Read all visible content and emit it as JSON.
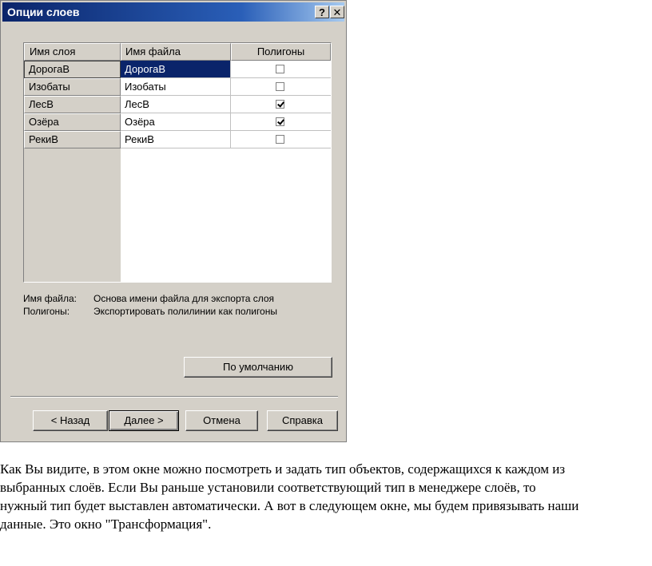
{
  "dialog": {
    "title": "Опции слоев",
    "help_button": "?",
    "close_button": "✕",
    "columns": [
      "Имя слоя",
      "Имя файла",
      "Полигоны"
    ],
    "rows": [
      {
        "layer": "ДорогаВ",
        "file": "ДорогаВ",
        "polygons": false,
        "selected": true
      },
      {
        "layer": "Изобаты",
        "file": "Изобаты",
        "polygons": false,
        "selected": false
      },
      {
        "layer": "ЛесВ",
        "file": "ЛесВ",
        "polygons": true,
        "selected": false
      },
      {
        "layer": "Озёра",
        "file": "Озёра",
        "polygons": true,
        "selected": false
      },
      {
        "layer": "РекиВ",
        "file": "РекиВ",
        "polygons": false,
        "selected": false
      }
    ],
    "legend": [
      {
        "key": "Имя файла:",
        "value": "Основа имени файла для экспорта слоя"
      },
      {
        "key": "Полигоны:",
        "value": "Экспортировать полилинии как полигоны"
      }
    ],
    "default_button": "По умолчанию",
    "back_button": "< Назад",
    "next_button": "Далее >",
    "cancel_button": "Отмена",
    "help_text_button": "Справка"
  },
  "paragraph": [
    "Как Вы видите, в этом окне можно посмотреть и задать тип объектов, содержащихся к каждом из",
    "выбранных слоёв. Если Вы раньше установили соответствующий тип в менеджере слоёв, то",
    "нужный тип будет выставлен автоматически. А вот в следующем окне, мы будем привязывать наши",
    "данные. Это окно \"Трансформация\"."
  ],
  "colors": {
    "title_bar": "#0a246a",
    "dialog_bg": "#d4d0c8",
    "selection": "#0a246a"
  }
}
